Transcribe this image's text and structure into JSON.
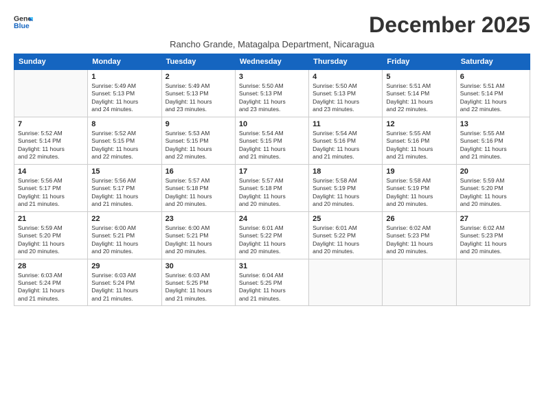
{
  "logo": {
    "line1": "General",
    "line2": "Blue"
  },
  "title": "December 2025",
  "subtitle": "Rancho Grande, Matagalpa Department, Nicaragua",
  "days_header": [
    "Sunday",
    "Monday",
    "Tuesday",
    "Wednesday",
    "Thursday",
    "Friday",
    "Saturday"
  ],
  "weeks": [
    [
      {
        "num": "",
        "info": ""
      },
      {
        "num": "1",
        "info": "Sunrise: 5:49 AM\nSunset: 5:13 PM\nDaylight: 11 hours\nand 24 minutes."
      },
      {
        "num": "2",
        "info": "Sunrise: 5:49 AM\nSunset: 5:13 PM\nDaylight: 11 hours\nand 23 minutes."
      },
      {
        "num": "3",
        "info": "Sunrise: 5:50 AM\nSunset: 5:13 PM\nDaylight: 11 hours\nand 23 minutes."
      },
      {
        "num": "4",
        "info": "Sunrise: 5:50 AM\nSunset: 5:13 PM\nDaylight: 11 hours\nand 23 minutes."
      },
      {
        "num": "5",
        "info": "Sunrise: 5:51 AM\nSunset: 5:14 PM\nDaylight: 11 hours\nand 22 minutes."
      },
      {
        "num": "6",
        "info": "Sunrise: 5:51 AM\nSunset: 5:14 PM\nDaylight: 11 hours\nand 22 minutes."
      }
    ],
    [
      {
        "num": "7",
        "info": "Sunrise: 5:52 AM\nSunset: 5:14 PM\nDaylight: 11 hours\nand 22 minutes."
      },
      {
        "num": "8",
        "info": "Sunrise: 5:52 AM\nSunset: 5:15 PM\nDaylight: 11 hours\nand 22 minutes."
      },
      {
        "num": "9",
        "info": "Sunrise: 5:53 AM\nSunset: 5:15 PM\nDaylight: 11 hours\nand 22 minutes."
      },
      {
        "num": "10",
        "info": "Sunrise: 5:54 AM\nSunset: 5:15 PM\nDaylight: 11 hours\nand 21 minutes."
      },
      {
        "num": "11",
        "info": "Sunrise: 5:54 AM\nSunset: 5:16 PM\nDaylight: 11 hours\nand 21 minutes."
      },
      {
        "num": "12",
        "info": "Sunrise: 5:55 AM\nSunset: 5:16 PM\nDaylight: 11 hours\nand 21 minutes."
      },
      {
        "num": "13",
        "info": "Sunrise: 5:55 AM\nSunset: 5:16 PM\nDaylight: 11 hours\nand 21 minutes."
      }
    ],
    [
      {
        "num": "14",
        "info": "Sunrise: 5:56 AM\nSunset: 5:17 PM\nDaylight: 11 hours\nand 21 minutes."
      },
      {
        "num": "15",
        "info": "Sunrise: 5:56 AM\nSunset: 5:17 PM\nDaylight: 11 hours\nand 21 minutes."
      },
      {
        "num": "16",
        "info": "Sunrise: 5:57 AM\nSunset: 5:18 PM\nDaylight: 11 hours\nand 20 minutes."
      },
      {
        "num": "17",
        "info": "Sunrise: 5:57 AM\nSunset: 5:18 PM\nDaylight: 11 hours\nand 20 minutes."
      },
      {
        "num": "18",
        "info": "Sunrise: 5:58 AM\nSunset: 5:19 PM\nDaylight: 11 hours\nand 20 minutes."
      },
      {
        "num": "19",
        "info": "Sunrise: 5:58 AM\nSunset: 5:19 PM\nDaylight: 11 hours\nand 20 minutes."
      },
      {
        "num": "20",
        "info": "Sunrise: 5:59 AM\nSunset: 5:20 PM\nDaylight: 11 hours\nand 20 minutes."
      }
    ],
    [
      {
        "num": "21",
        "info": "Sunrise: 5:59 AM\nSunset: 5:20 PM\nDaylight: 11 hours\nand 20 minutes."
      },
      {
        "num": "22",
        "info": "Sunrise: 6:00 AM\nSunset: 5:21 PM\nDaylight: 11 hours\nand 20 minutes."
      },
      {
        "num": "23",
        "info": "Sunrise: 6:00 AM\nSunset: 5:21 PM\nDaylight: 11 hours\nand 20 minutes."
      },
      {
        "num": "24",
        "info": "Sunrise: 6:01 AM\nSunset: 5:22 PM\nDaylight: 11 hours\nand 20 minutes."
      },
      {
        "num": "25",
        "info": "Sunrise: 6:01 AM\nSunset: 5:22 PM\nDaylight: 11 hours\nand 20 minutes."
      },
      {
        "num": "26",
        "info": "Sunrise: 6:02 AM\nSunset: 5:23 PM\nDaylight: 11 hours\nand 20 minutes."
      },
      {
        "num": "27",
        "info": "Sunrise: 6:02 AM\nSunset: 5:23 PM\nDaylight: 11 hours\nand 20 minutes."
      }
    ],
    [
      {
        "num": "28",
        "info": "Sunrise: 6:03 AM\nSunset: 5:24 PM\nDaylight: 11 hours\nand 21 minutes."
      },
      {
        "num": "29",
        "info": "Sunrise: 6:03 AM\nSunset: 5:24 PM\nDaylight: 11 hours\nand 21 minutes."
      },
      {
        "num": "30",
        "info": "Sunrise: 6:03 AM\nSunset: 5:25 PM\nDaylight: 11 hours\nand 21 minutes."
      },
      {
        "num": "31",
        "info": "Sunrise: 6:04 AM\nSunset: 5:25 PM\nDaylight: 11 hours\nand 21 minutes."
      },
      {
        "num": "",
        "info": ""
      },
      {
        "num": "",
        "info": ""
      },
      {
        "num": "",
        "info": ""
      }
    ]
  ]
}
